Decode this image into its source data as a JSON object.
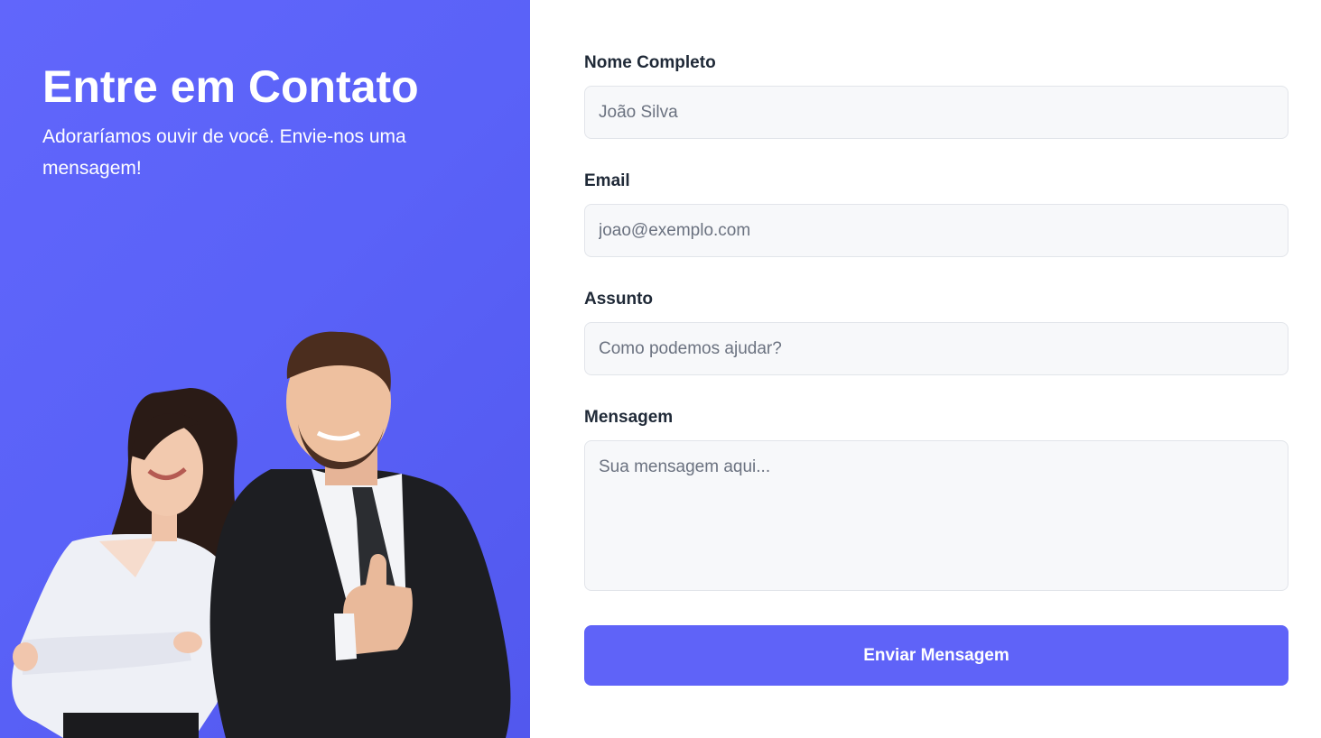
{
  "hero": {
    "title": "Entre em Contato",
    "subtitle": "Adoraríamos ouvir de você. Envie-nos uma mensagem!",
    "image": "smiling-business-team-photo"
  },
  "form": {
    "name": {
      "label": "Nome Completo",
      "placeholder": "João Silva",
      "value": ""
    },
    "email": {
      "label": "Email",
      "placeholder": "joao@exemplo.com",
      "value": ""
    },
    "subject": {
      "label": "Assunto",
      "placeholder": "Como podemos ajudar?",
      "value": ""
    },
    "message": {
      "label": "Mensagem",
      "placeholder": "Sua mensagem aqui...",
      "value": ""
    },
    "submit_label": "Enviar Mensagem"
  },
  "colors": {
    "accent": "#5f63f8",
    "panel": "#5a62f8",
    "field_bg": "#f7f8fa",
    "label": "#1f2937"
  }
}
